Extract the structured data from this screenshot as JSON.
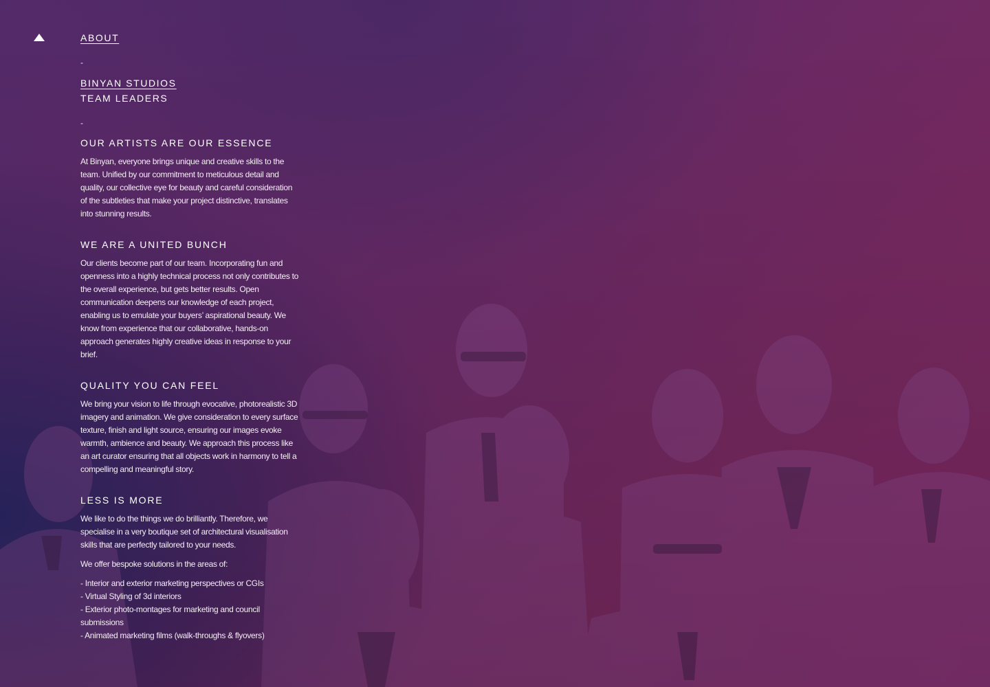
{
  "nav": {
    "about": "About",
    "separator1": "-",
    "studios": "Binyan Studios",
    "team_leaders": "Team Leaders",
    "separator2": "-"
  },
  "sections": [
    {
      "heading": "Our Artists Are Our Essence",
      "body": "At Binyan, everyone brings unique and creative skills to the team. Unified by our commitment to meticulous detail and quality, our collective eye for beauty and careful consideration of the subtleties that make your project distinctive, translates into stunning results."
    },
    {
      "heading": "We Are A United Bunch",
      "body": "Our clients become part of our team. Incorporating fun and openness into a highly technical process not only contributes to the overall experience, but gets better results. Open communication deepens our knowledge of each project, enabling us to emulate your buyers’ aspirational beauty. We know from experience that our collaborative, hands-on approach generates highly creative ideas in response to your brief."
    },
    {
      "heading": "Quality You Can Feel",
      "body": "We bring your vision to life through evocative, photorealistic 3D imagery and animation. We give consideration to every surface texture, finish and light source, ensuring our images evoke warmth, ambience and beauty. We approach this process like an art curator ensuring that all objects work in harmony to tell a compelling and meaningful story."
    },
    {
      "heading": "Less Is More",
      "body": "We like to do the things we do brilliantly. Therefore, we specialise in a very boutique set of architectural visualisation skills that are perfectly tailored to your needs.",
      "body2": "We offer bespoke solutions in the areas of:",
      "list": [
        "- Interior and exterior marketing perspectives or CGIs",
        "- Virtual Styling of 3d interiors",
        "- Exterior photo-montages for marketing and council submissions",
        "- Animated marketing films (walk-throughs & flyovers)"
      ]
    }
  ],
  "icons": {
    "toggle": "triangle-up-icon"
  },
  "colors": {
    "gradient_left": "#2a2a6a",
    "gradient_mid": "#5e2a68",
    "gradient_right": "#7e2a60",
    "text": "#ffffff"
  }
}
